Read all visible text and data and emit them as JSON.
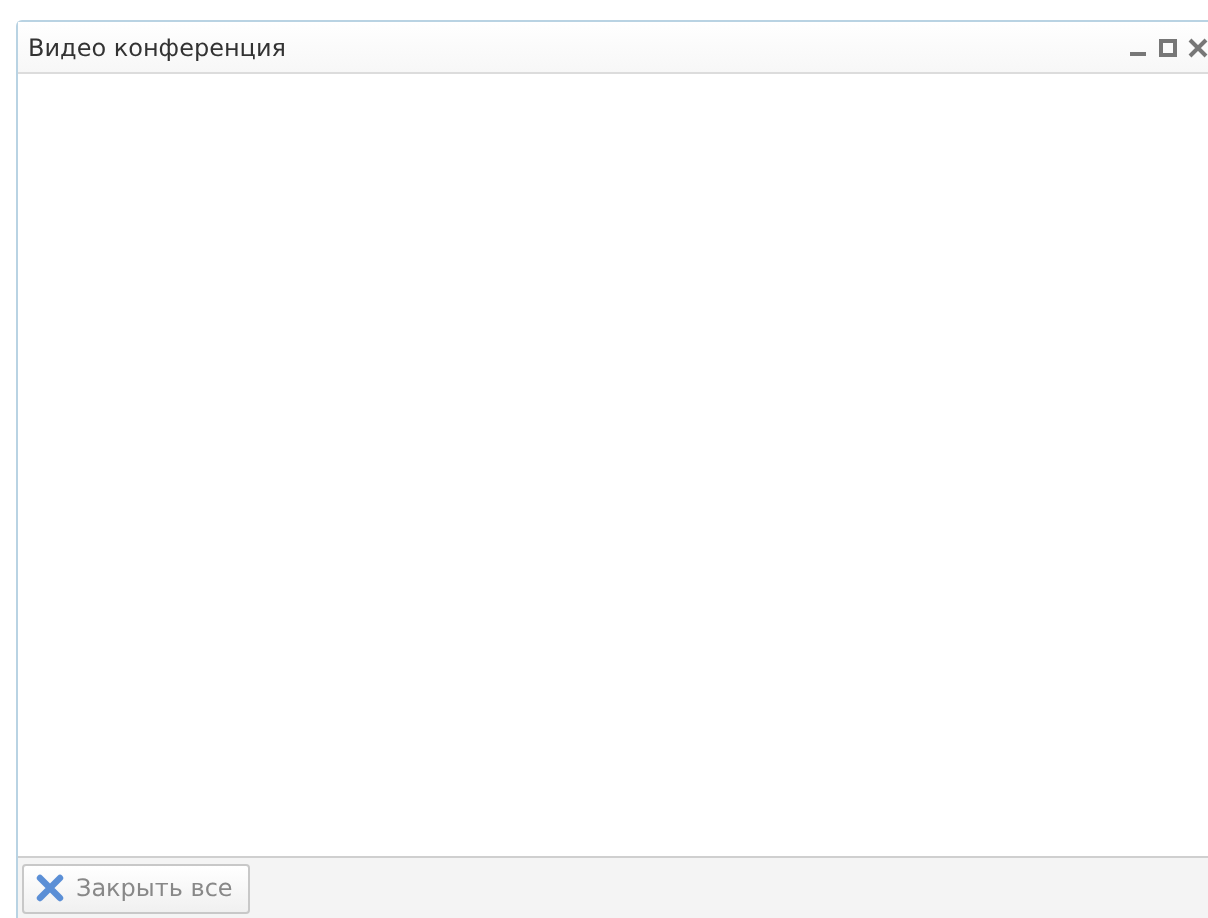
{
  "window": {
    "title": "Видео конференция"
  },
  "footer": {
    "buttons": [
      {
        "label": "Закрыть все"
      }
    ]
  }
}
